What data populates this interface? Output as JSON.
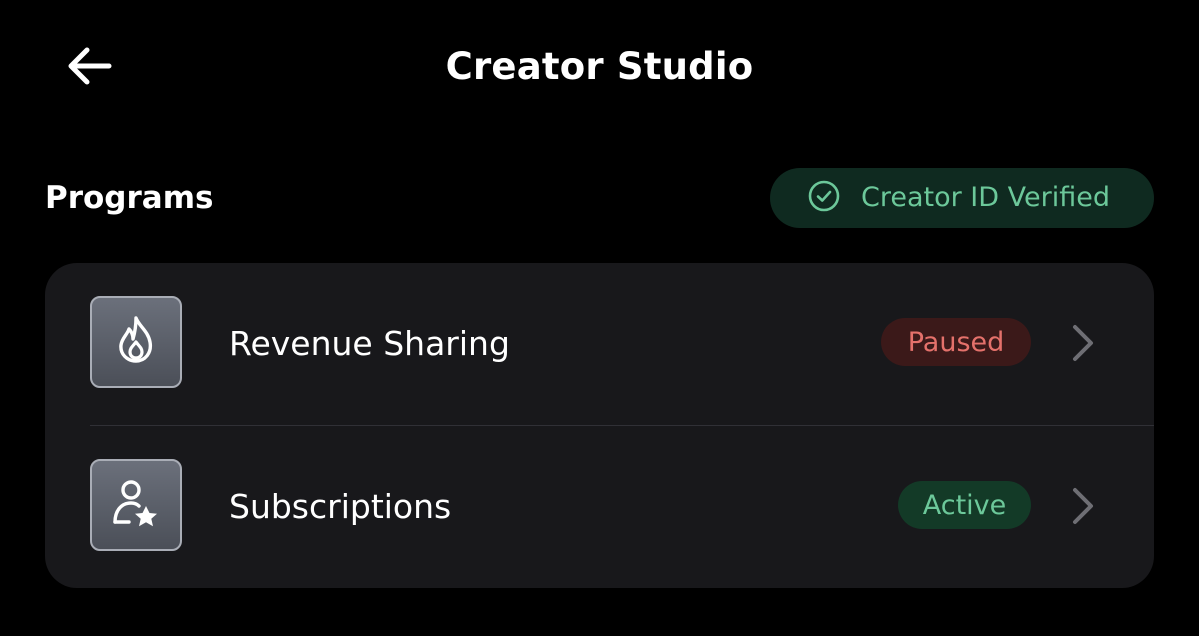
{
  "header": {
    "title": "Creator Studio",
    "back_icon": "arrow-left-icon"
  },
  "section": {
    "title": "Programs"
  },
  "verification": {
    "label": "Creator ID Verified",
    "icon": "check-circle-icon",
    "color": "#6cc89a",
    "background": "#0f2a20"
  },
  "programs": [
    {
      "label": "Revenue Sharing",
      "icon": "flame-icon",
      "status": "Paused",
      "status_color": "#e4716b",
      "status_background": "#3b1919",
      "chevron": "chevron-right-icon"
    },
    {
      "label": "Subscriptions",
      "icon": "user-star-icon",
      "status": "Active",
      "status_color": "#6cc89a",
      "status_background": "#133a27",
      "chevron": "chevron-right-icon"
    }
  ],
  "colors": {
    "background": "#000000",
    "card": "#18181b"
  }
}
